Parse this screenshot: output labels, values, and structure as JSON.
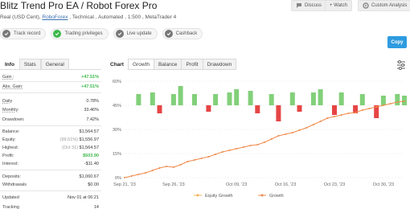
{
  "header": {
    "title": "Blitz Trend Pro EA / Robot Forex Pro",
    "subtitle_pre": "Real (USD Cent), ",
    "subtitle_link": "RoboForex",
    "subtitle_post": " , Technical , Automated , 1:500 , MetaTrader 4",
    "buttons": {
      "discuss": "Discuss",
      "watch": "+ Watch",
      "custom": "Custom Analysis"
    }
  },
  "badges": {
    "track": "Track record",
    "privileges": "Trading privileges",
    "live": "Live update",
    "cashback": "Cashback"
  },
  "copy_label": "Copy",
  "left_tabs": {
    "info": "Info",
    "stats": "Stats",
    "general": "General"
  },
  "stats": {
    "gain_label": "Gain :",
    "gain_value": "+47.51%",
    "abs_label": "Abs. Gain:",
    "abs_value": "+47.51%",
    "daily_label": "Daily",
    "daily_value": "0.78%",
    "monthly_label": "Monthly:",
    "monthly_value": "33.46%",
    "drawdown_label": "Drawdown:",
    "drawdown_value": "7.42%",
    "balance_label": "Balance:",
    "balance_value": "$1,564.57",
    "equity_label": "Equity:",
    "equity_pct": "(99.51%)",
    "equity_value": "$1,556.97",
    "highest_label": "Highest:",
    "highest_date": "(Oct 31)",
    "highest_value": "$1,564.57",
    "profit_label": "Profit:",
    "profit_value": "$503.90",
    "interest_label": "Interest:",
    "interest_value": "-$11.40",
    "deposits_label": "Deposits:",
    "deposits_value": "$1,060.67",
    "withdrawals_label": "Withdrawals",
    "withdrawals_value": "$0.00",
    "updated_label": "Updated",
    "updated_value": "Nov 01 at 06:21",
    "tracking_label": "Tracking",
    "tracking_value": "14"
  },
  "right_tabs": {
    "chart": "Chart",
    "growth": "Growth",
    "balance": "Balance",
    "profit": "Profit",
    "drawdown": "Drawdown"
  },
  "colors": {
    "accent": "#2e9be0",
    "green": "#3cb84b",
    "red": "#e64545",
    "line": "#f08a4b",
    "bar_pos": "#82d07a",
    "bar_neg": "#e64545"
  },
  "chart_data": {
    "type": "line",
    "title": "",
    "y_ticks": [
      "0%",
      "15%",
      "30%",
      "45%",
      "60%"
    ],
    "ylim": [
      0,
      60
    ],
    "x_ticks": [
      "Sep 21, '23",
      "Sep 26, '23",
      "Oct 09, '23",
      "Oct 16, '23",
      "Oct 23, '23",
      "Oct 30, '23"
    ],
    "xlim": [
      0,
      40
    ],
    "x_tick_positions": [
      0,
      7,
      16,
      23,
      30,
      37
    ],
    "legend": [
      "Equity Growth",
      "Growth"
    ],
    "legend_position": "bottom",
    "growth_series": [
      [
        0,
        0
      ],
      [
        1,
        1
      ],
      [
        2,
        2
      ],
      [
        3,
        3
      ],
      [
        4,
        4.5
      ],
      [
        5,
        6
      ],
      [
        6,
        7
      ],
      [
        7,
        6.5
      ],
      [
        8,
        8
      ],
      [
        9,
        10
      ],
      [
        10,
        11
      ],
      [
        11,
        12
      ],
      [
        12,
        13
      ],
      [
        13,
        14.5
      ],
      [
        14,
        16
      ],
      [
        15,
        17
      ],
      [
        16,
        18
      ],
      [
        17,
        19
      ],
      [
        18,
        20
      ],
      [
        19,
        20.5
      ],
      [
        20,
        22
      ],
      [
        21,
        24
      ],
      [
        22,
        26
      ],
      [
        23,
        27
      ],
      [
        24,
        28
      ],
      [
        25,
        29.5
      ],
      [
        26,
        31
      ],
      [
        27,
        33
      ],
      [
        28,
        35
      ],
      [
        29,
        37
      ],
      [
        30,
        38
      ],
      [
        31,
        39
      ],
      [
        32,
        40
      ],
      [
        33,
        40.5
      ],
      [
        34,
        42
      ],
      [
        35,
        43
      ],
      [
        36,
        44
      ],
      [
        37,
        45
      ],
      [
        38,
        46
      ],
      [
        39,
        47
      ],
      [
        40,
        47.5
      ]
    ],
    "bars": [
      {
        "x": 2,
        "pos": 7,
        "neg": 0
      },
      {
        "x": 4,
        "pos": 8,
        "neg": 0
      },
      {
        "x": 5,
        "pos": 0,
        "neg": 5
      },
      {
        "x": 7,
        "pos": 7,
        "neg": 0
      },
      {
        "x": 8,
        "pos": 12,
        "neg": 0
      },
      {
        "x": 10,
        "pos": 7,
        "neg": 0
      },
      {
        "x": 12,
        "pos": 0,
        "neg": 4
      },
      {
        "x": 13,
        "pos": 7,
        "neg": 0
      },
      {
        "x": 15,
        "pos": 8,
        "neg": 0
      },
      {
        "x": 16,
        "pos": 10,
        "neg": 0
      },
      {
        "x": 18,
        "pos": 9,
        "neg": 0
      },
      {
        "x": 19,
        "pos": 0,
        "neg": 5
      },
      {
        "x": 21,
        "pos": 7,
        "neg": 0
      },
      {
        "x": 22,
        "pos": 0,
        "neg": 10
      },
      {
        "x": 24,
        "pos": 8,
        "neg": 0
      },
      {
        "x": 25,
        "pos": 0,
        "neg": 4
      },
      {
        "x": 27,
        "pos": 8,
        "neg": 0
      },
      {
        "x": 28,
        "pos": 10,
        "neg": 0
      },
      {
        "x": 30,
        "pos": 0,
        "neg": 6
      },
      {
        "x": 31,
        "pos": 8,
        "neg": 0
      },
      {
        "x": 33,
        "pos": 0,
        "neg": 5
      },
      {
        "x": 34,
        "pos": 7,
        "neg": 0
      },
      {
        "x": 36,
        "pos": 0,
        "neg": 8
      },
      {
        "x": 37,
        "pos": 6,
        "neg": 0
      },
      {
        "x": 39,
        "pos": 7,
        "neg": 0
      },
      {
        "x": 40,
        "pos": 6,
        "neg": 0
      }
    ]
  }
}
